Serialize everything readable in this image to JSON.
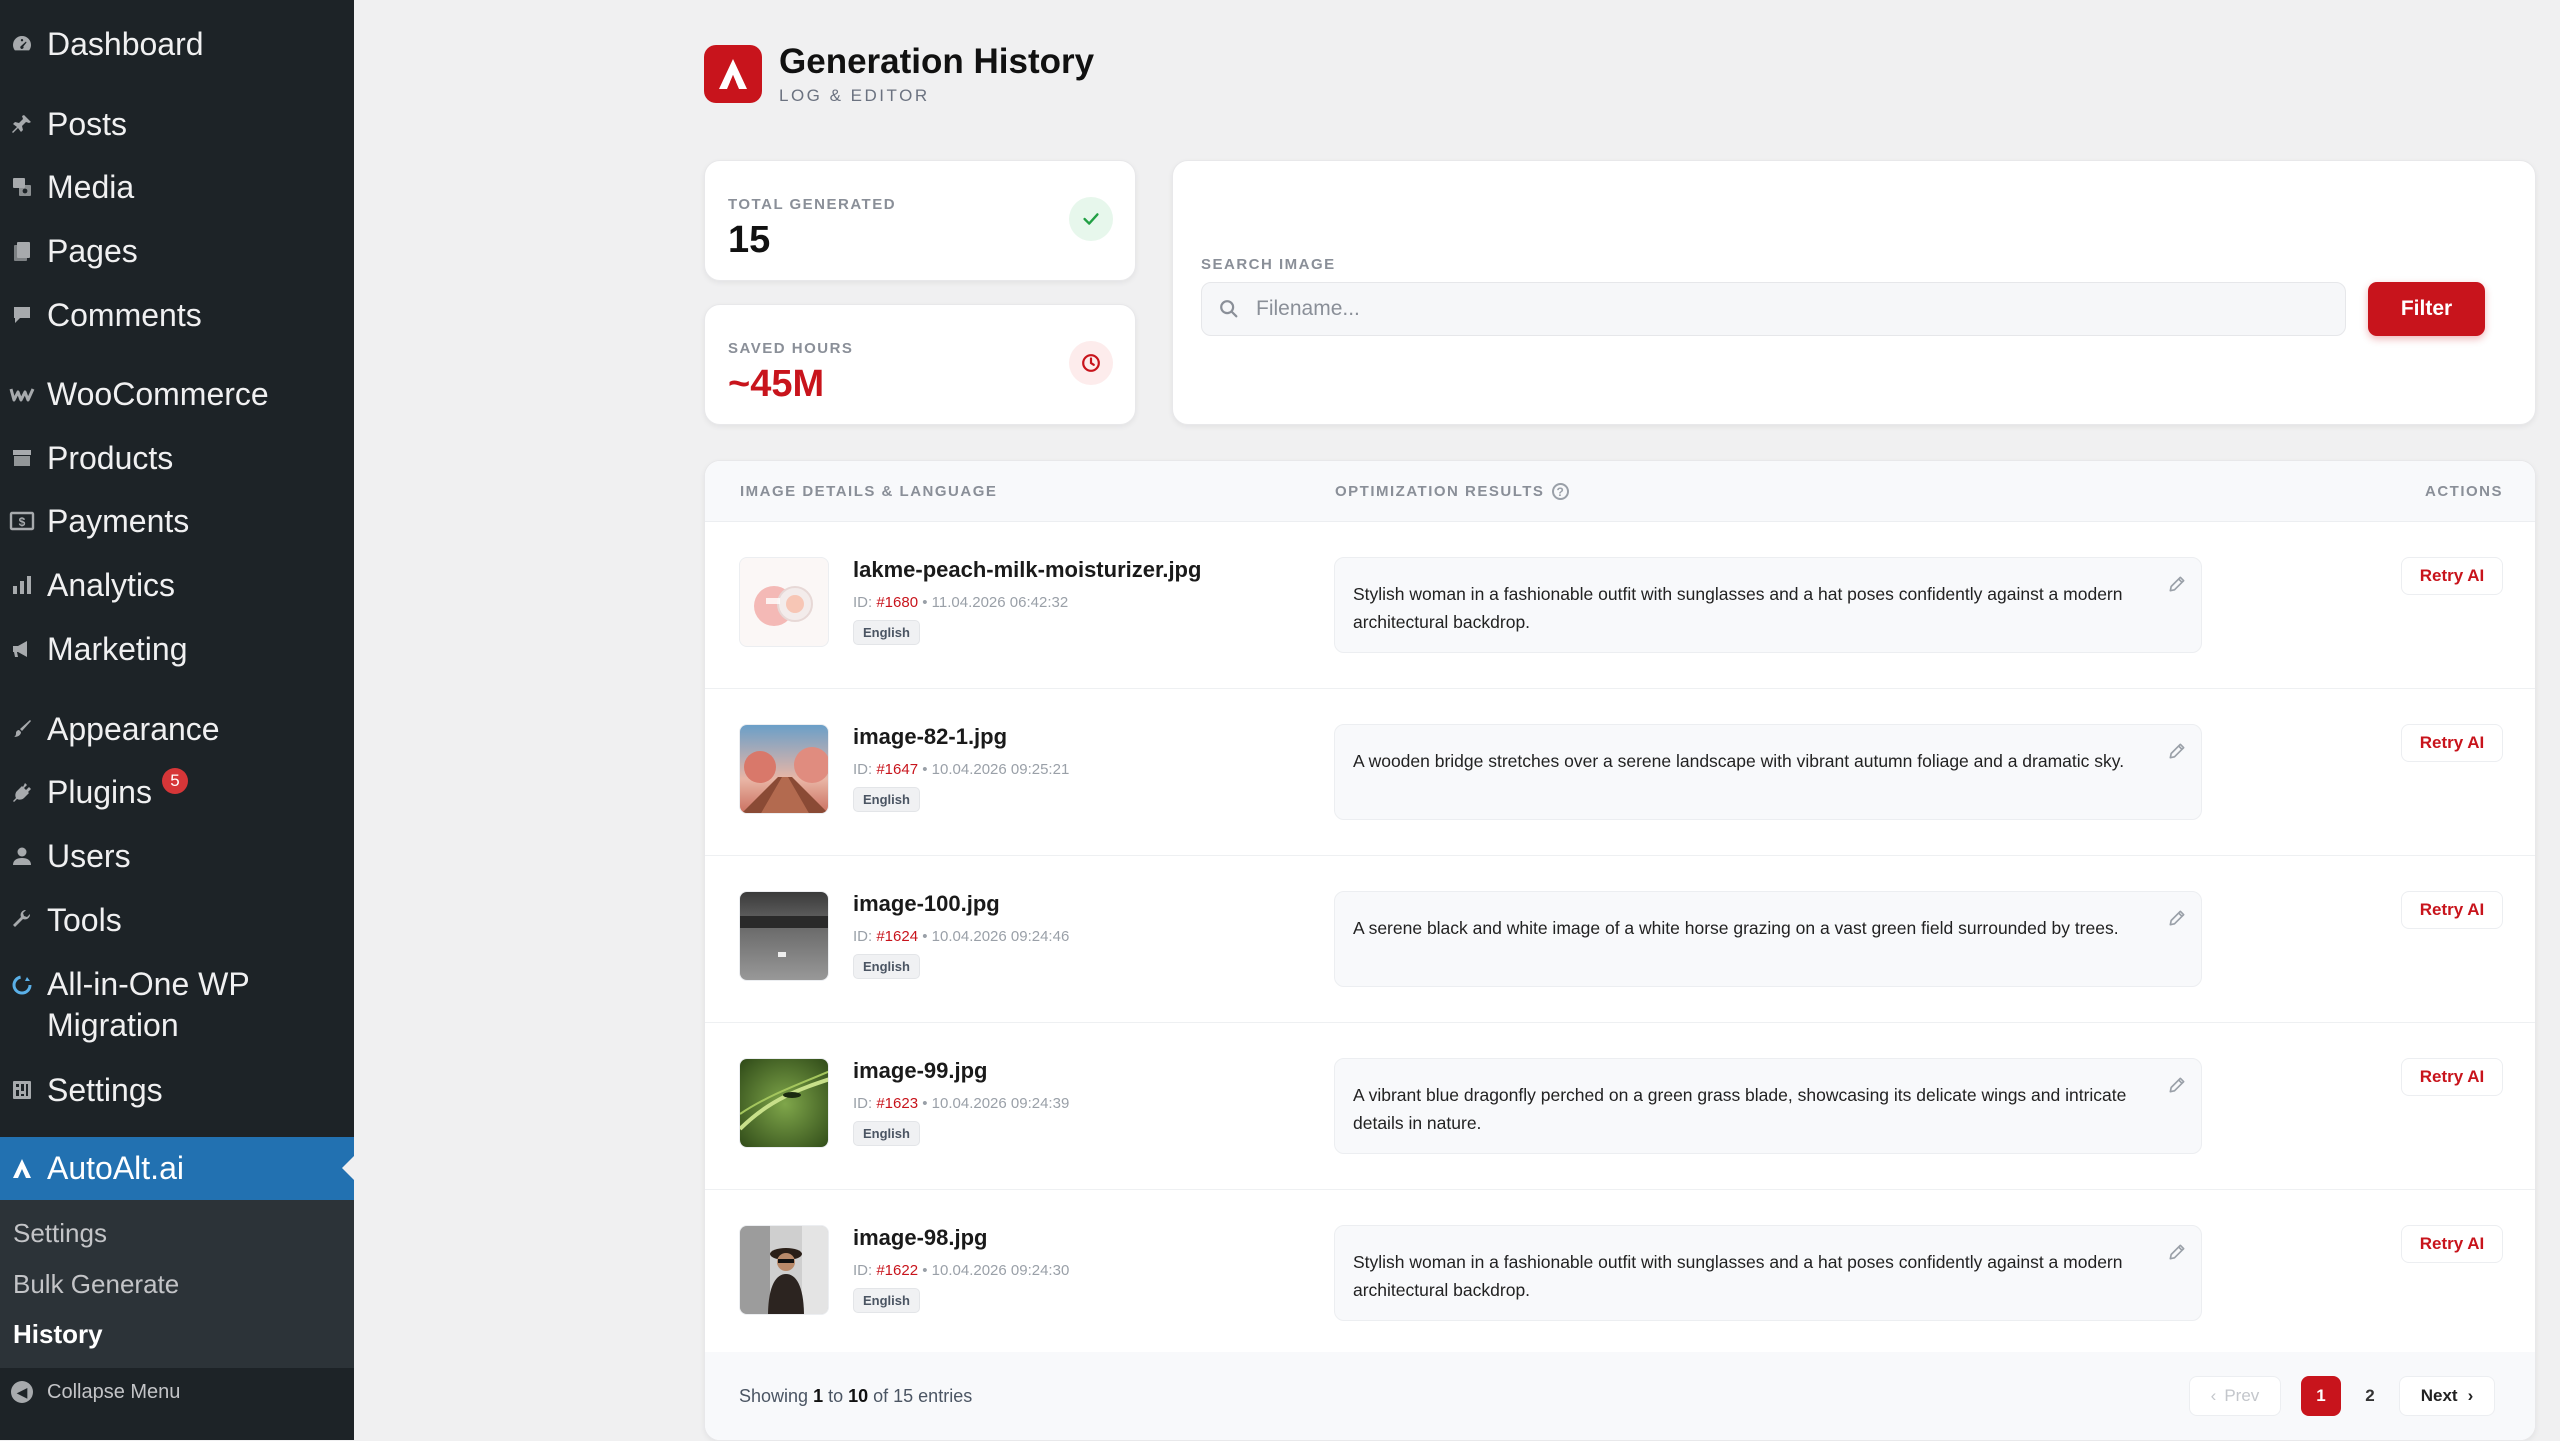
{
  "sidebar": {
    "items": [
      {
        "label": "Dashboard",
        "icon": "dashboard-icon"
      },
      {
        "label": "Posts",
        "icon": "pin-icon"
      },
      {
        "label": "Media",
        "icon": "media-icon"
      },
      {
        "label": "Pages",
        "icon": "pages-icon"
      },
      {
        "label": "Comments",
        "icon": "comment-icon"
      },
      {
        "label": "WooCommerce",
        "icon": "woo-icon"
      },
      {
        "label": "Products",
        "icon": "archive-icon"
      },
      {
        "label": "Payments",
        "icon": "money-icon"
      },
      {
        "label": "Analytics",
        "icon": "chart-bar-icon"
      },
      {
        "label": "Marketing",
        "icon": "megaphone-icon"
      },
      {
        "label": "Appearance",
        "icon": "brush-icon"
      },
      {
        "label": "Plugins",
        "icon": "plugin-icon",
        "badge": "5"
      },
      {
        "label": "Users",
        "icon": "user-icon"
      },
      {
        "label": "Tools",
        "icon": "wrench-icon"
      },
      {
        "label": "All-in-One WP Migration",
        "icon": "migration-icon"
      },
      {
        "label": "Settings",
        "icon": "settings-icon"
      },
      {
        "label": "AutoAlt.ai",
        "icon": "autoalt-icon"
      }
    ],
    "submenu": [
      {
        "label": "Settings"
      },
      {
        "label": "Bulk Generate"
      },
      {
        "label": "History"
      }
    ],
    "collapse_label": "Collapse Menu"
  },
  "header": {
    "title": "Generation History",
    "subtitle": "LOG & EDITOR"
  },
  "stats": {
    "total_label": "TOTAL GENERATED",
    "total_value": "15",
    "saved_label": "SAVED HOURS",
    "saved_value": "~45M"
  },
  "search": {
    "label": "SEARCH IMAGE",
    "placeholder": "Filename...",
    "button": "Filter"
  },
  "table": {
    "col_details": "IMAGE DETAILS & LANGUAGE",
    "col_results": "OPTIMIZATION RESULTS",
    "col_actions": "ACTIONS",
    "retry_label": "Retry AI",
    "id_prefix": "ID: ",
    "rows": [
      {
        "filename": "lakme-peach-milk-moisturizer.jpg",
        "id": "#1680",
        "date": "11.04.2026 06:42:32",
        "lang": "English",
        "result": "Stylish woman in a fashionable outfit with sunglasses and a hat poses confidently against a modern architectural backdrop."
      },
      {
        "filename": "image-82-1.jpg",
        "id": "#1647",
        "date": "10.04.2026 09:25:21",
        "lang": "English",
        "result": "A wooden bridge stretches over a serene landscape with vibrant autumn foliage and a dramatic sky."
      },
      {
        "filename": "image-100.jpg",
        "id": "#1624",
        "date": "10.04.2026 09:24:46",
        "lang": "English",
        "result": "A serene black and white image of a white horse grazing on a vast green field surrounded by trees."
      },
      {
        "filename": "image-99.jpg",
        "id": "#1623",
        "date": "10.04.2026 09:24:39",
        "lang": "English",
        "result": "A vibrant blue dragonfly perched on a green grass blade, showcasing its delicate wings and intricate details in nature."
      },
      {
        "filename": "image-98.jpg",
        "id": "#1622",
        "date": "10.04.2026 09:24:30",
        "lang": "English",
        "result": "Stylish woman in a fashionable outfit with sunglasses and a hat poses confidently against a modern architectural backdrop."
      }
    ]
  },
  "footer": {
    "showing_prefix": "Showing ",
    "from": "1",
    "to_word": " to ",
    "to": "10",
    "of_word": " of ",
    "total": "15",
    "suffix": " entries",
    "prev": "Prev",
    "page1": "1",
    "page2": "2",
    "next": "Next"
  },
  "colors": {
    "accent": "#c8141c",
    "sidebar_bg": "#1d2327",
    "active_menu": "#2271b1"
  }
}
